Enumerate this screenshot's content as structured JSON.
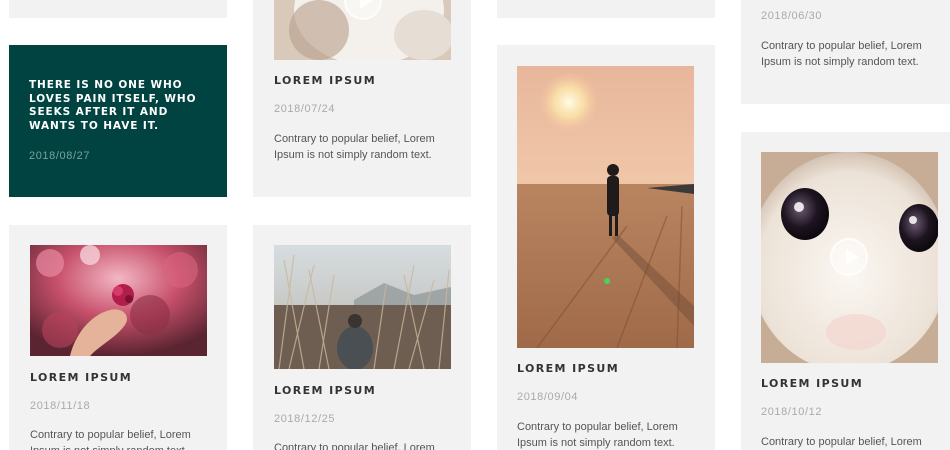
{
  "quote_card": {
    "text": "THERE IS NO ONE WHO LOVES PAIN ITSELF, WHO SEEKS AFTER IT AND WANTS TO HAVE IT.",
    "date": "2018/08/27"
  },
  "cards": [
    {
      "id": "cat-video-top",
      "title": "LOREM IPSUM",
      "date": "2018/07/24",
      "text": "Contrary to popular belief, Lorem Ipsum is not simply random text."
    },
    {
      "id": "top-right",
      "title": "",
      "date": "2018/06/30",
      "text": "Contrary to popular belief, Lorem Ipsum is not simply random text."
    },
    {
      "id": "flower",
      "title": "LOREM IPSUM",
      "date": "2018/11/18",
      "text": "Contrary to popular belief, Lorem Ipsum is not simply random text."
    },
    {
      "id": "grass",
      "title": "LOREM IPSUM",
      "date": "2018/12/25",
      "text": "Contrary to popular belief, Lorem Ipsum is not simply random text."
    },
    {
      "id": "beach",
      "title": "LOREM IPSUM",
      "date": "2018/09/04",
      "text": "Contrary to popular belief, Lorem Ipsum is not simply random text."
    },
    {
      "id": "cat-video",
      "title": "LOREM IPSUM",
      "date": "2018/10/12",
      "text": "Contrary to popular belief, Lorem Ipsum is not simply random text."
    }
  ],
  "colors": {
    "card_bg": "#f2f2f2",
    "quote_bg": "#004341",
    "title": "#333333",
    "date": "#aaaaaa",
    "body": "#555555"
  },
  "icons": {
    "play": "play-icon"
  }
}
